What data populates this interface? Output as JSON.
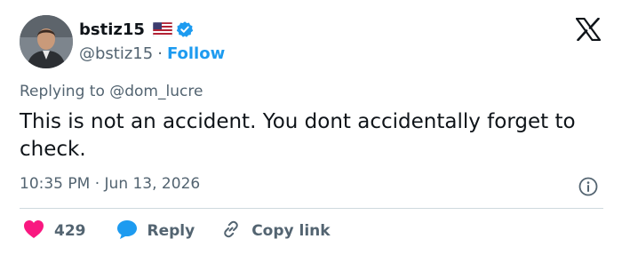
{
  "author": {
    "display_name": "bstiz15",
    "handle": "@bstiz15",
    "separator": "·",
    "follow_label": "Follow"
  },
  "tweet": {
    "replying_to": "Replying to @dom_lucre",
    "text": "This is not an accident. You dont accidentally forget to check.",
    "timestamp": "10:35 PM · Jun 13, 2026"
  },
  "actions": {
    "likes": "429",
    "reply_label": "Reply",
    "copy_label": "Copy link"
  },
  "colors": {
    "link": "#1d9bf0",
    "like": "#f91880",
    "muted": "#536471",
    "text": "#0f1419"
  },
  "icons": [
    "flag-us-icon",
    "verified-badge-icon",
    "x-logo-icon",
    "info-icon",
    "heart-icon",
    "speech-bubble-icon",
    "link-icon"
  ]
}
